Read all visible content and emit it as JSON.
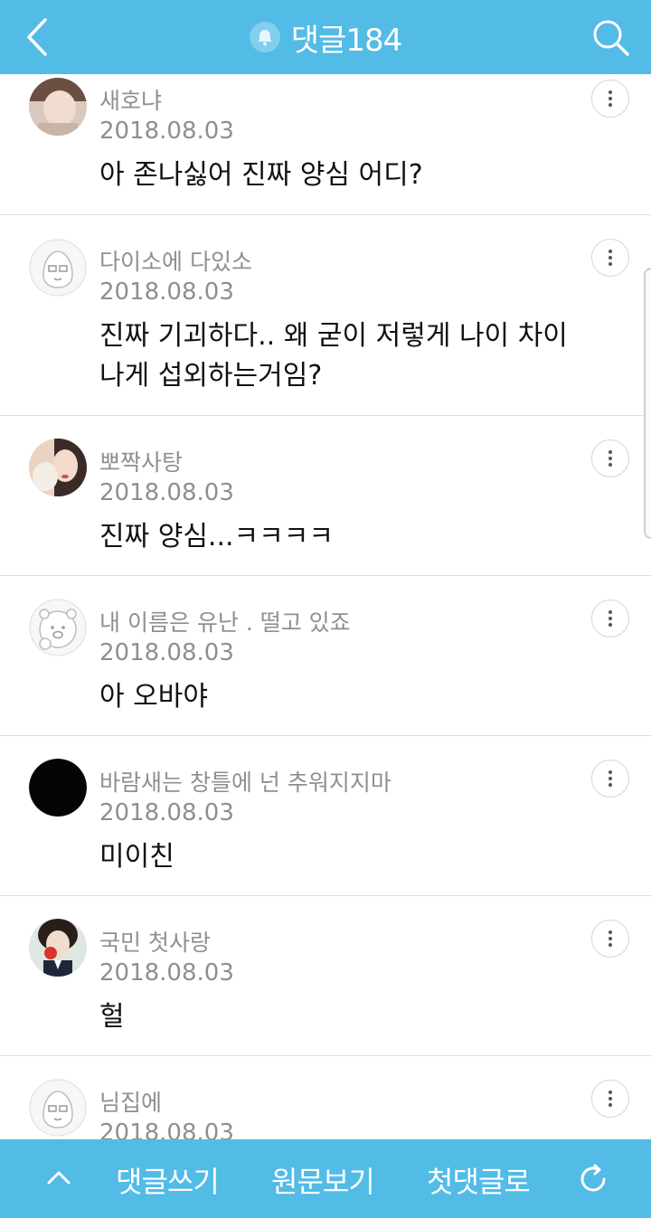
{
  "header": {
    "title": "댓글184",
    "back_icon": "chevron-left-icon",
    "bell_icon": "bell-icon",
    "search_icon": "search-icon"
  },
  "comments": [
    {
      "nickname": "새호냐",
      "date": "2018.08.03",
      "text": "아 존나싫어 진짜 양심 어디?",
      "avatar": "photo"
    },
    {
      "nickname": "다이소에 다있소",
      "date": "2018.08.03",
      "text": "진짜 기괴하다.. 왜 굳이 저렇게 나이 차이 나게 섭외하는거임?",
      "avatar": "default-peach"
    },
    {
      "nickname": "뽀짝사탕",
      "date": "2018.08.03",
      "text": "진짜 양심...ㅋㅋㅋㅋ",
      "avatar": "photo"
    },
    {
      "nickname": "내 이름은 유난 . 떨고 있죠",
      "date": "2018.08.03",
      "text": "아 오바야",
      "avatar": "default-bear"
    },
    {
      "nickname": "바람새는 창틀에 넌 추워지지마",
      "date": "2018.08.03",
      "text": "미이친",
      "avatar": "black"
    },
    {
      "nickname": "국민 첫사랑",
      "date": "2018.08.03",
      "text": "헐",
      "avatar": "photo"
    },
    {
      "nickname": "님집에",
      "date": "2018.08.03",
      "text": "",
      "avatar": "default-peach"
    }
  ],
  "footer": {
    "write_label": "댓글쓰기",
    "original_label": "원문보기",
    "first_label": "첫댓글로",
    "up_icon": "chevron-up-icon",
    "refresh_icon": "refresh-icon"
  },
  "colors": {
    "bar": "#52bbe6",
    "meta_text": "#8f8f8f",
    "body_text": "#111111",
    "divider": "#dcdcdc"
  }
}
